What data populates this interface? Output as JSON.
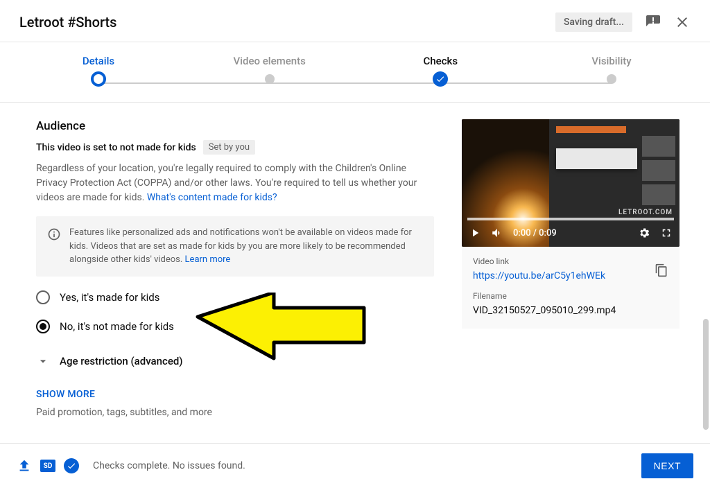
{
  "header": {
    "title": "Letroot #Shorts",
    "saving": "Saving draft..."
  },
  "stepper": {
    "details": "Details",
    "video_elements": "Video elements",
    "checks": "Checks",
    "visibility": "Visibility"
  },
  "audience": {
    "section_title": "Audience",
    "status_text": "This video is set to not made for kids",
    "set_by": "Set by you",
    "legal_prefix": "Regardless of your location, you're legally required to comply with the Children's Online Privacy Protection Act (COPPA) and/or other laws. You're required to tell us whether your videos are made for kids. ",
    "legal_link": "What's content made for kids?",
    "info_prefix": "Features like personalized ads and notifications won't be available on videos made for kids. Videos that are set as made for kids by you are more likely to be recommended alongside other kids' videos. ",
    "info_link": "Learn more",
    "radio_yes": "Yes, it's made for kids",
    "radio_no": "No, it's not made for kids",
    "age_restriction": "Age restriction (advanced)"
  },
  "more": {
    "show_more": "SHOW MORE",
    "subtitle": "Paid promotion, tags, subtitles, and more"
  },
  "preview": {
    "time": "0:00 / 0:09",
    "watermark": "LETROOT.COM",
    "link_label": "Video link",
    "link_value": "https://youtu.be/arC5y1ehWEk",
    "filename_label": "Filename",
    "filename_value": "VID_32150527_095010_299.mp4"
  },
  "footer": {
    "status": "Checks complete. No issues found.",
    "next": "NEXT",
    "sd": "SD"
  }
}
